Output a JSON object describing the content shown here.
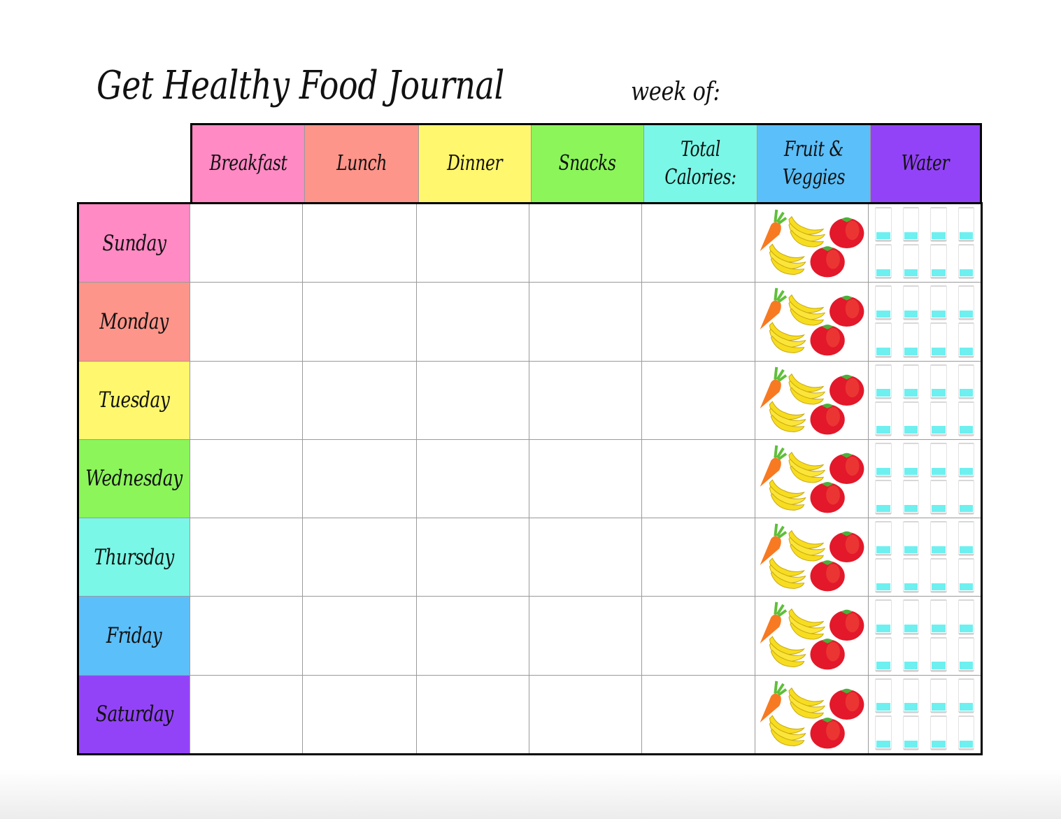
{
  "title": "Get Healthy Food Journal",
  "week_label": "week of:",
  "columns": [
    {
      "label": "Breakfast",
      "color": "#ff8ac4"
    },
    {
      "label": "Lunch",
      "color": "#fd958a"
    },
    {
      "label": "Dinner",
      "color": "#fff76e"
    },
    {
      "label": "Snacks",
      "color": "#8bf55a"
    },
    {
      "label": "Total Calories:",
      "color": "#7af7e6"
    },
    {
      "label": "Fruit & Veggies",
      "color": "#5bbff9"
    },
    {
      "label": "Water",
      "color": "#9343f7"
    }
  ],
  "days": [
    {
      "label": "Sunday",
      "color": "#ff8ac4"
    },
    {
      "label": "Monday",
      "color": "#fd958a"
    },
    {
      "label": "Tuesday",
      "color": "#fff76e"
    },
    {
      "label": "Wednesday",
      "color": "#8bf55a"
    },
    {
      "label": "Thursday",
      "color": "#7af7e6"
    },
    {
      "label": "Friday",
      "color": "#5bbff9"
    },
    {
      "label": "Saturday",
      "color": "#9343f7"
    }
  ],
  "produce_icons": [
    "carrot-icon",
    "banana-bunch-icon",
    "tomato-icon",
    "banana-bunch-icon",
    "tomato-icon"
  ],
  "water": {
    "glasses_per_day": 8,
    "fill_level": 0.22,
    "fill_color": "#6ef0f0"
  },
  "entries": {
    "breakfast": [
      "",
      "",
      "",
      "",
      "",
      "",
      ""
    ],
    "lunch": [
      "",
      "",
      "",
      "",
      "",
      "",
      ""
    ],
    "dinner": [
      "",
      "",
      "",
      "",
      "",
      "",
      ""
    ],
    "snacks": [
      "",
      "",
      "",
      "",
      "",
      "",
      ""
    ],
    "total_calories": [
      "",
      "",
      "",
      "",
      "",
      "",
      ""
    ]
  }
}
